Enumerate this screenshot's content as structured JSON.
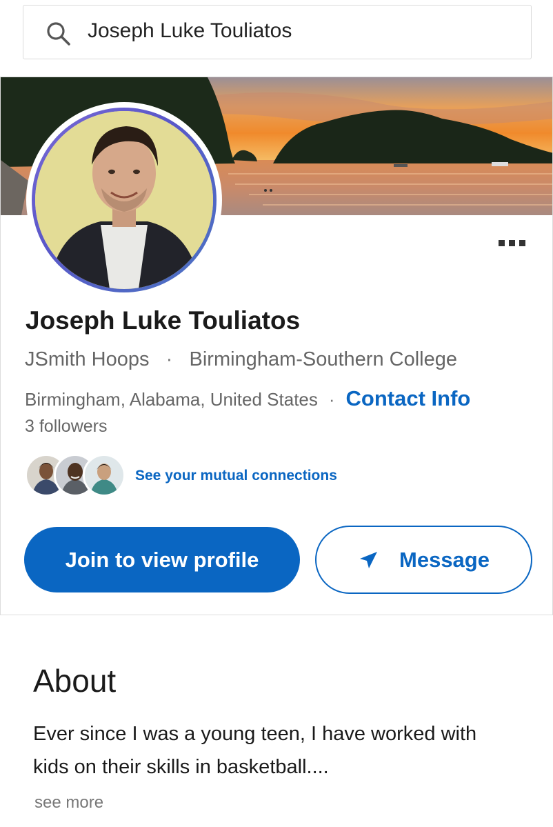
{
  "search": {
    "query": "Joseph Luke Touliatos",
    "icon": "search-icon"
  },
  "profile": {
    "name": "Joseph Luke Touliatos",
    "company": "JSmith Hoops",
    "separator": "·",
    "school": "Birmingham-Southern College",
    "location": "Birmingham, Alabama, United States",
    "location_separator": "·",
    "contact_info": "Contact Info",
    "followers": "3 followers"
  },
  "mutual": {
    "label": "See your mutual connections"
  },
  "actions": {
    "join": "Join to view profile",
    "message": "Message"
  },
  "about": {
    "title": "About",
    "text": "Ever since I was a young teen, I have worked with kids on their skills in basketball....",
    "see_more": "see more"
  },
  "colors": {
    "accent": "#0a66c2",
    "text": "#1a1a1a",
    "muted": "#666666"
  }
}
